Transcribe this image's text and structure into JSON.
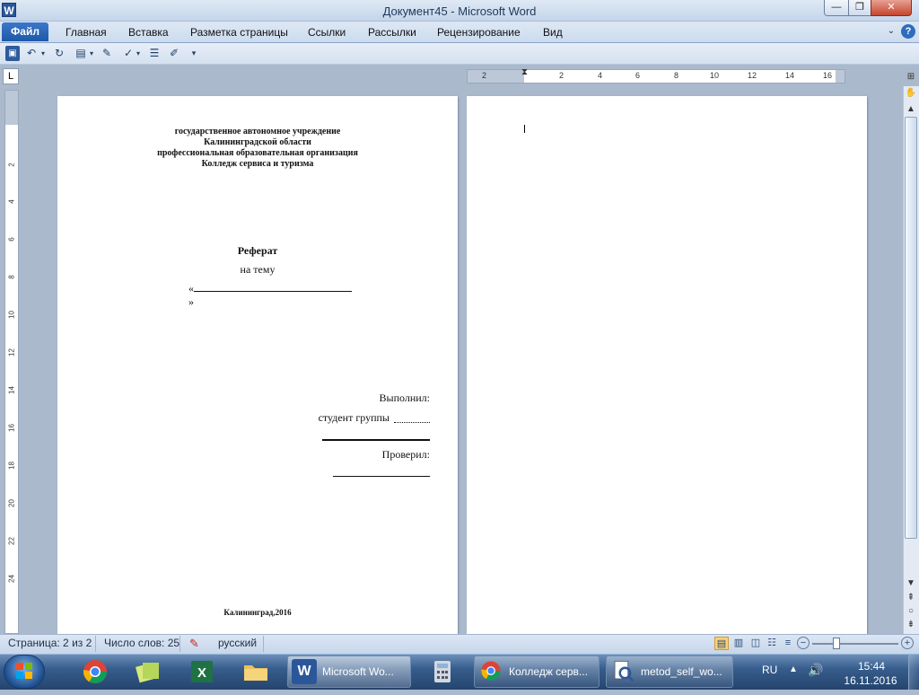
{
  "window": {
    "title": "Документ45 - Microsoft Word",
    "app_icon": "W",
    "minimize": "—",
    "maximize": "❐",
    "close": "✕"
  },
  "ribbon": {
    "file_tab": "Файл",
    "tabs": [
      "Главная",
      "Вставка",
      "Разметка страницы",
      "Ссылки",
      "Рассылки",
      "Рецензирование",
      "Вид"
    ],
    "help": "?"
  },
  "quick_access": {
    "icons": [
      "save-icon",
      "undo-icon",
      "redo-icon",
      "new-document-icon",
      "highlight-icon",
      "spelling-icon",
      "bullets-icon",
      "format-painter-icon",
      "customize-icon"
    ]
  },
  "ruler": {
    "horizontal_ticks": [
      "2",
      "2",
      "4",
      "6",
      "8",
      "10",
      "12",
      "14",
      "16"
    ],
    "vertical_ticks": [
      "2",
      "4",
      "6",
      "8",
      "10",
      "12",
      "14",
      "16",
      "18",
      "20",
      "22",
      "24"
    ],
    "corner": "L"
  },
  "document": {
    "page1": {
      "header_lines": [
        "государственное автономное учреждение",
        "Калининградской области",
        "профессиональная образовательная организация",
        "Колледж сервиса и туризма"
      ],
      "title": "Реферат",
      "subtitle": "на тему",
      "topic_open": "«",
      "topic_close": "»",
      "done_by": "Выполнил:",
      "student_group": "студент группы",
      "checked_by": "Проверил:",
      "city_year": "Калининград,2016"
    }
  },
  "status_bar": {
    "page": "Страница: 2 из 2",
    "words": "Число слов: 25",
    "language": "русский",
    "zoom_minus": "−",
    "zoom_plus": "+"
  },
  "taskbar": {
    "items": [
      {
        "label": "Microsoft Wo...",
        "icon": "word-icon"
      },
      {
        "label": "Колледж серв...",
        "icon": "chrome-icon"
      },
      {
        "label": "metod_self_wo...",
        "icon": "document-viewer-icon"
      }
    ],
    "pinned": [
      "chrome-icon",
      "folder-icon",
      "excel-icon",
      "explorer-icon",
      "calculator-icon"
    ],
    "tray": {
      "lang": "RU",
      "time": "15:44",
      "date": "16.11.2016"
    }
  },
  "colors": {
    "accent": "#2b579a",
    "file_tab": "#1e58a8",
    "taskbar": "#375d8d"
  }
}
